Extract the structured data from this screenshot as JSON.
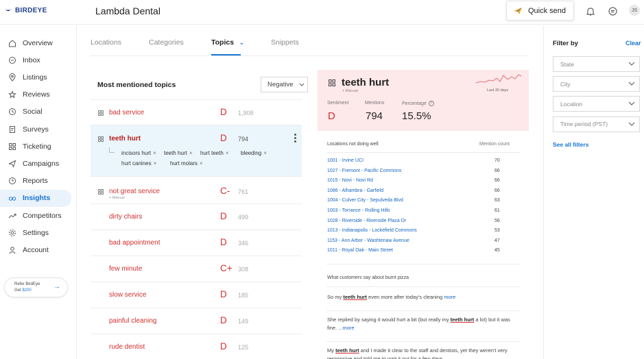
{
  "brand": {
    "logo_text": "BIRDEYE",
    "color": "#1f3e8a"
  },
  "header": {
    "business_name": "Lambda Dental",
    "quick_send_label": "Quick send",
    "avatar_initials": "JS"
  },
  "sidebar": {
    "items": [
      {
        "label": "Overview",
        "icon": "home-icon"
      },
      {
        "label": "Inbox",
        "icon": "chat-icon"
      },
      {
        "label": "Listings",
        "icon": "location-pin-icon"
      },
      {
        "label": "Reviews",
        "icon": "star-icon"
      },
      {
        "label": "Social",
        "icon": "social-icon"
      },
      {
        "label": "Surveys",
        "icon": "survey-icon"
      },
      {
        "label": "Ticketing",
        "icon": "ticketing-icon"
      },
      {
        "label": "Campaigns",
        "icon": "send-icon"
      },
      {
        "label": "Reports",
        "icon": "clock-icon"
      },
      {
        "label": "Insights",
        "icon": "insights-icon",
        "active": true
      },
      {
        "label": "Competitors",
        "icon": "trend-icon"
      },
      {
        "label": "Settings",
        "icon": "gear-icon"
      },
      {
        "label": "Account",
        "icon": "user-icon"
      }
    ],
    "refer": {
      "line1": "Refer BirdEye",
      "line2_prefix": "Get ",
      "line2_amount": "$200"
    }
  },
  "tabs": [
    {
      "label": "Locations"
    },
    {
      "label": "Categories"
    },
    {
      "label": "Topics",
      "active": true
    },
    {
      "label": "Snippets"
    }
  ],
  "topics_panel": {
    "title": "Most mentioned topics",
    "sentiment_filter": "Negative",
    "topics": [
      {
        "name": "bad service",
        "grade": "D",
        "count": "1,908",
        "has_icon": true
      },
      {
        "name": "teeth hurt",
        "grade": "D",
        "count": "794",
        "has_icon": true,
        "selected": true,
        "snippets": [
          "incisors hurt",
          "teeth hurt",
          "hurt teeth",
          "bleeding",
          "hurt canines",
          "hurt molars"
        ]
      },
      {
        "name": "not great service",
        "grade": "C-",
        "count": "761",
        "has_icon": true,
        "manual": "+ Manual"
      },
      {
        "name": "dirty chairs",
        "grade": "D",
        "count": "499"
      },
      {
        "name": "bad appointment",
        "grade": "D",
        "count": "346"
      },
      {
        "name": "few minute",
        "grade": "C+",
        "count": "308"
      },
      {
        "name": "slow service",
        "grade": "D",
        "count": "185"
      },
      {
        "name": "painful cleaning",
        "grade": "D",
        "count": "149"
      },
      {
        "name": "rude dentist",
        "grade": "D",
        "count": "125"
      }
    ]
  },
  "detail": {
    "title": "teeth hurt",
    "manual": "+ Manual",
    "period": "Last 30 days",
    "sentiment_label": "Sentiment",
    "sentiment_value": "D",
    "mentions_label": "Mentions",
    "mentions_value": "794",
    "percentage_label": "Percentage",
    "percentage_value": "15.5%",
    "locations_title": "Locations not doing well",
    "mention_count_label": "Mention count",
    "locations": [
      {
        "name": "1001 - Irvine UCI",
        "count": "70"
      },
      {
        "name": "1027 - Fremont - Pacific Commons",
        "count": "66"
      },
      {
        "name": "1015 - Novi - Novi Rd",
        "count": "66"
      },
      {
        "name": "1086 - Alhambra - Garfield",
        "count": "66"
      },
      {
        "name": "1004 - Culver City - Sepulveda Blvd",
        "count": "63"
      },
      {
        "name": "1003 - Torrance - Rolling Hills",
        "count": "61"
      },
      {
        "name": "1028 - Riverside - Riverside Plaza Dr",
        "count": "56"
      },
      {
        "name": "1013 - Indianapolis - Lockefield Commons",
        "count": "53"
      },
      {
        "name": "1153 - Ann Arbor - Washtenaw Avenue",
        "count": "47"
      },
      {
        "name": "1011 - Royal Oak - Main Street",
        "count": "45"
      }
    ],
    "quotes_title": "What customers say about burnt pizza",
    "quotes": [
      {
        "pre": "So my ",
        "kw": "teeth hurt",
        "post": " even more after today's cleaning ",
        "more": "more"
      },
      {
        "pre": "She replied by saying it would hurt a bit (but really my ",
        "kw": "teeth hurt",
        "post": " a lot) but it was fine. ",
        "more": "...more"
      },
      {
        "pre": "My ",
        "kw": "teeth hurt",
        "post": " and I made it clear to the staff and dentists, yet they weren't very responsive and told me to wait it out for a few days",
        "more": ""
      }
    ]
  },
  "filters": {
    "title": "Filter by",
    "clear": "Clear",
    "fields": [
      "State",
      "City",
      "Location",
      "Time period (PST)"
    ],
    "see_all": "See all filters"
  },
  "colors": {
    "accent": "#1976d2",
    "negative": "#d32f2f",
    "card_bg": "#fde8ea",
    "selected_bg": "#eaf6fb"
  }
}
